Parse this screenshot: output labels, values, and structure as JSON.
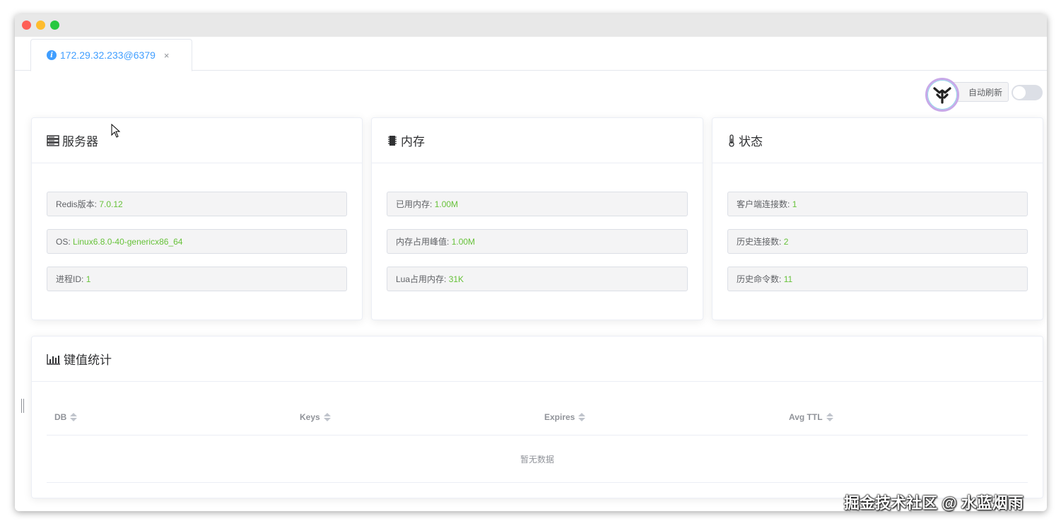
{
  "tab": {
    "title": "172.29.32.233@6379",
    "close": "×"
  },
  "toolbar": {
    "auto_refresh_label": "自动刷新",
    "auto_refresh_on": false
  },
  "cards": {
    "server": {
      "title": "服务器",
      "rows": [
        {
          "label": "Redis版本:",
          "value": "7.0.12"
        },
        {
          "label": "OS:",
          "value": "Linux6.8.0-40-genericx86_64"
        },
        {
          "label": "进程ID:",
          "value": "1"
        }
      ]
    },
    "memory": {
      "title": "内存",
      "rows": [
        {
          "label": "已用内存:",
          "value": "1.00M"
        },
        {
          "label": "内存占用峰值:",
          "value": "1.00M"
        },
        {
          "label": "Lua占用内存:",
          "value": "31K"
        }
      ]
    },
    "status": {
      "title": "状态",
      "rows": [
        {
          "label": "客户端连接数:",
          "value": "1"
        },
        {
          "label": "历史连接数:",
          "value": "2"
        },
        {
          "label": "历史命令数:",
          "value": "11"
        }
      ]
    }
  },
  "keystats": {
    "title": "键值统计",
    "columns": [
      "DB",
      "Keys",
      "Expires",
      "Avg TTL"
    ],
    "empty_text": "暂无数据"
  },
  "watermark": "掘金技术社区 @ 水蓝烟雨",
  "colors": {
    "accent": "#409eff",
    "value_green": "#67c23a"
  }
}
